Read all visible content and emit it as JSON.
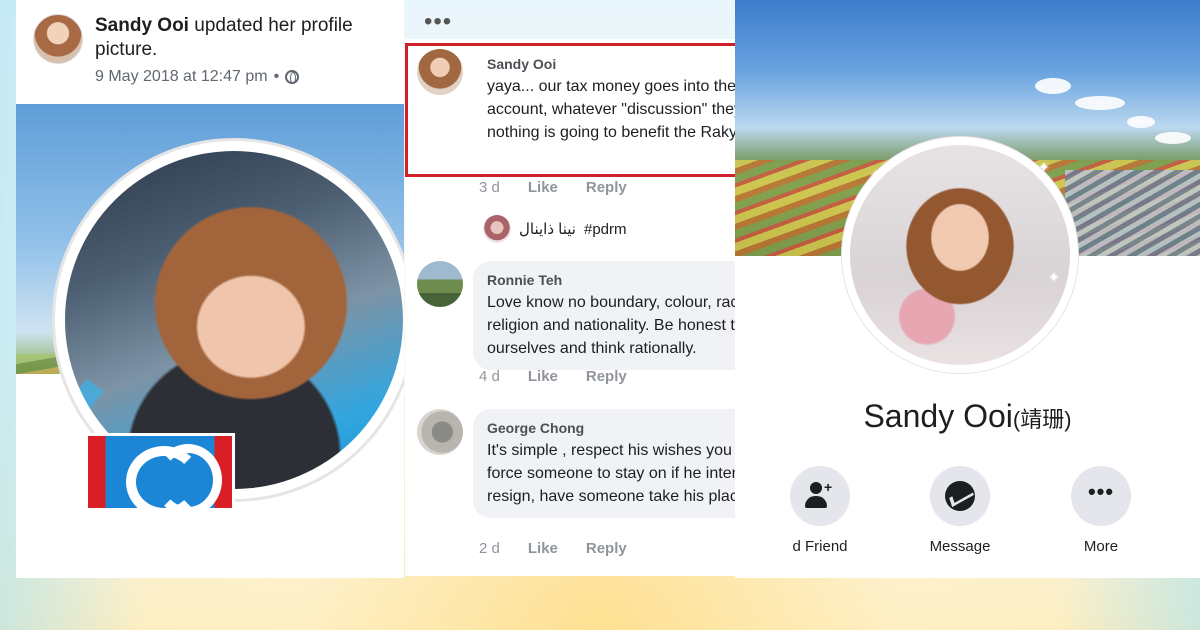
{
  "post": {
    "author": "Sandy Ooi",
    "action_text": "updated her profile picture.",
    "timestamp": "9 May 2018 at 12:47 pm",
    "separator": "•",
    "privacy_icon": "globe-icon",
    "more_icon": "more-dots-icon",
    "more_glyph": "•••"
  },
  "comments": [
    {
      "name": "Sandy Ooi",
      "text": "yaya... our tax money goes into their bank account, whatever \"discussion\" they have, nothing is going to benefit the Rakyat.",
      "time": "3 d",
      "like": "Like",
      "reply": "Reply",
      "highlighted": true
    },
    {
      "name": "Ronnie Teh",
      "text": "Love know no boundary, colour, race, religion and nationality. Be honest to ourselves and think rationally.",
      "time": "4 d",
      "like": "Like",
      "reply": "Reply"
    },
    {
      "name": "George Chong",
      "text": "It's simple , respect his wishes you can't force someone to stay on if he intend to resign, have someone take his place",
      "time": "2 d",
      "like": "Like",
      "reply": "Reply"
    }
  ],
  "reply_preview": {
    "name": "نينا ذاينال",
    "text": "#pdrm"
  },
  "profile": {
    "name": "Sandy Ooi",
    "name_cn": "(靖珊)",
    "actions": [
      {
        "label": "d Friend",
        "icon": "add-friend-icon"
      },
      {
        "label": "Message",
        "icon": "messenger-icon"
      },
      {
        "label": "More",
        "icon": "more-dots-icon"
      }
    ]
  },
  "colors": {
    "highlight_border": "#d0212a",
    "bubble_bg": "#f0f2f5",
    "meta_text": "#90949c",
    "action_circle": "#e4e6eb"
  }
}
